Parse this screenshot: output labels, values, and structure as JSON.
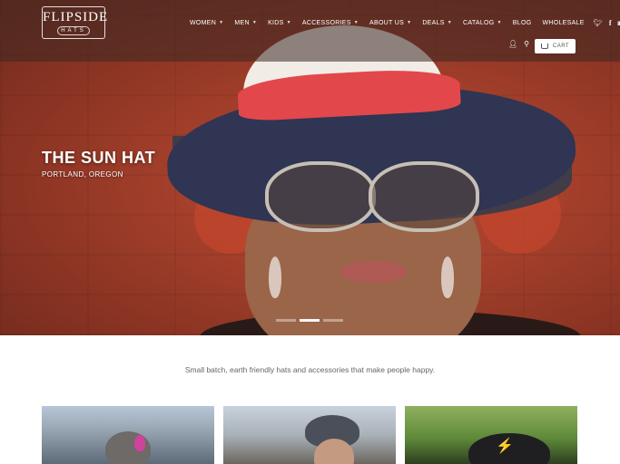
{
  "brand": {
    "logo_top": "FLIPSIDE",
    "logo_bottom": "HATS"
  },
  "nav": {
    "items": [
      {
        "label": "WOMEN",
        "has_dropdown": true
      },
      {
        "label": "MEN",
        "has_dropdown": true
      },
      {
        "label": "KIDS",
        "has_dropdown": true
      },
      {
        "label": "ACCESSORIES",
        "has_dropdown": true
      },
      {
        "label": "ABOUT US",
        "has_dropdown": true
      },
      {
        "label": "DEALS",
        "has_dropdown": true
      },
      {
        "label": "CATALOG",
        "has_dropdown": true
      },
      {
        "label": "BLOG",
        "has_dropdown": false
      },
      {
        "label": "WHOLESALE",
        "has_dropdown": false
      }
    ],
    "social": [
      "twitter-icon",
      "facebook-icon",
      "instagram-icon",
      "email-icon"
    ]
  },
  "utility": {
    "account_icon": "user-icon",
    "search_icon": "search-icon",
    "cart_label": "CART"
  },
  "hero": {
    "title": "THE SUN HAT",
    "subtitle": "PORTLAND, OREGON",
    "slides_count": 3,
    "active_slide": 2
  },
  "tagline": "Small batch, earth friendly hats and accessories that make people happy.",
  "colors": {
    "accent_cart_bg": "#ffffff",
    "hero_bg": "#a5402c",
    "text_muted": "#666666"
  }
}
